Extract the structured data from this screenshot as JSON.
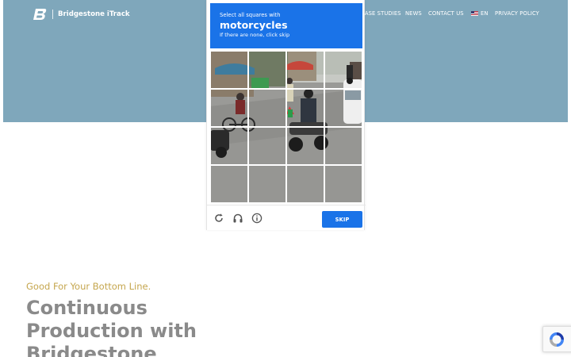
{
  "site": {
    "brand": "Bridgestone iTrack",
    "nav": {
      "case_studies": "CASE STUDIES",
      "news": "NEWS",
      "contact_us": "CONTACT US",
      "language": "EN",
      "privacy_policy": "PRIVACY POLICY"
    },
    "tagline": "Good For Your Bottom Line.",
    "headline": "Continuous Production with Bridgestone"
  },
  "captcha": {
    "instruction": "Select all squares with",
    "object": "motorcycles",
    "hint": "If there are none, click skip",
    "skip_label": "SKIP",
    "footer_icons": [
      "reload-icon",
      "headphones-icon",
      "info-icon"
    ],
    "grid_rows": 4,
    "grid_cols": 4
  },
  "colors": {
    "hero_bg": "#7fa7bb",
    "captcha_blue": "#1a73e8",
    "tagline_gold": "#c5a64e",
    "headline_gray": "#8a8a8a"
  }
}
